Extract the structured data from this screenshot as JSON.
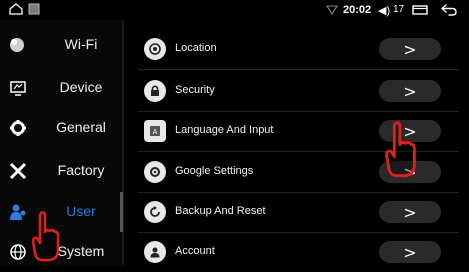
{
  "status_bar": {
    "left_icons": [
      "home-icon",
      "image-icon"
    ],
    "right_icons": [
      "wifi-signal-icon",
      "volume-icon",
      "recent-apps-icon",
      "back-icon"
    ],
    "time": "20:02",
    "volume_level": "17"
  },
  "sidebar": {
    "items": [
      {
        "label": "Wi-Fi",
        "icon": "wifi-icon",
        "active": false
      },
      {
        "label": "Device",
        "icon": "device-icon",
        "active": false
      },
      {
        "label": "General",
        "icon": "gear-icon",
        "active": false
      },
      {
        "label": "Factory",
        "icon": "tools-icon",
        "active": false
      },
      {
        "label": "User",
        "icon": "user-icon",
        "active": true
      },
      {
        "label": "System",
        "icon": "globe-icon",
        "active": false
      }
    ]
  },
  "settings": {
    "rows": [
      {
        "label": "Location",
        "icon": "location-icon"
      },
      {
        "label": "Security",
        "icon": "lock-icon"
      },
      {
        "label": "Language And Input",
        "icon": "keyboard-icon"
      },
      {
        "label": "Google Settings",
        "icon": "gear-icon"
      },
      {
        "label": "Backup And Reset",
        "icon": "backup-icon"
      },
      {
        "label": "Account",
        "icon": "account-icon"
      }
    ],
    "button_glyph": ">"
  },
  "colors": {
    "active": "#2f7de1",
    "pointer_outline": "#e0201a"
  }
}
